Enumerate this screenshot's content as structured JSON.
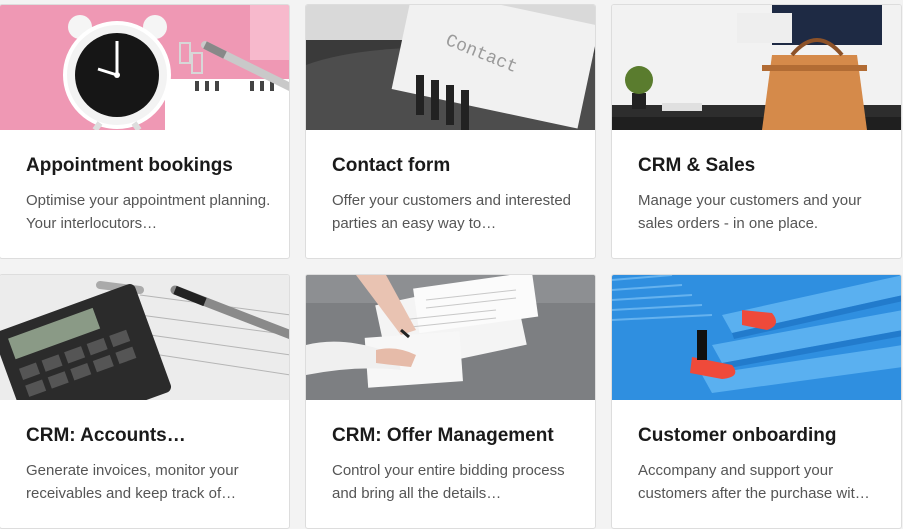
{
  "cards": [
    {
      "title": "Appointment bookings",
      "description": "Optimise your appointment planning. Your interlocutors…",
      "image_alt": "alarm-clock-calendar-photo"
    },
    {
      "title": "Contact form",
      "description": "Offer your customers and interested parties an easy way to…",
      "image_alt": "typewriter-photo",
      "image_text": "Contact"
    },
    {
      "title": "CRM & Sales",
      "description": "Manage your customers and your sales orders - in one place.",
      "image_alt": "businessman-bag-photo"
    },
    {
      "title": "CRM: Accounts…",
      "description": "Generate invoices, monitor your receivables and keep track of…",
      "image_alt": "calculator-pen-photo"
    },
    {
      "title": "CRM: Offer Management",
      "description": "Control your entire bidding process and bring all the details…",
      "image_alt": "signing-documents-photo"
    },
    {
      "title": "Customer onboarding",
      "description": "Accompany and support your customers after the purchase wit…",
      "image_alt": "stairs-sneakers-photo"
    }
  ],
  "colors": {
    "pink": "#ef98b4",
    "stairs": "#2f8fe0",
    "shoe": "#ef4a3a"
  }
}
